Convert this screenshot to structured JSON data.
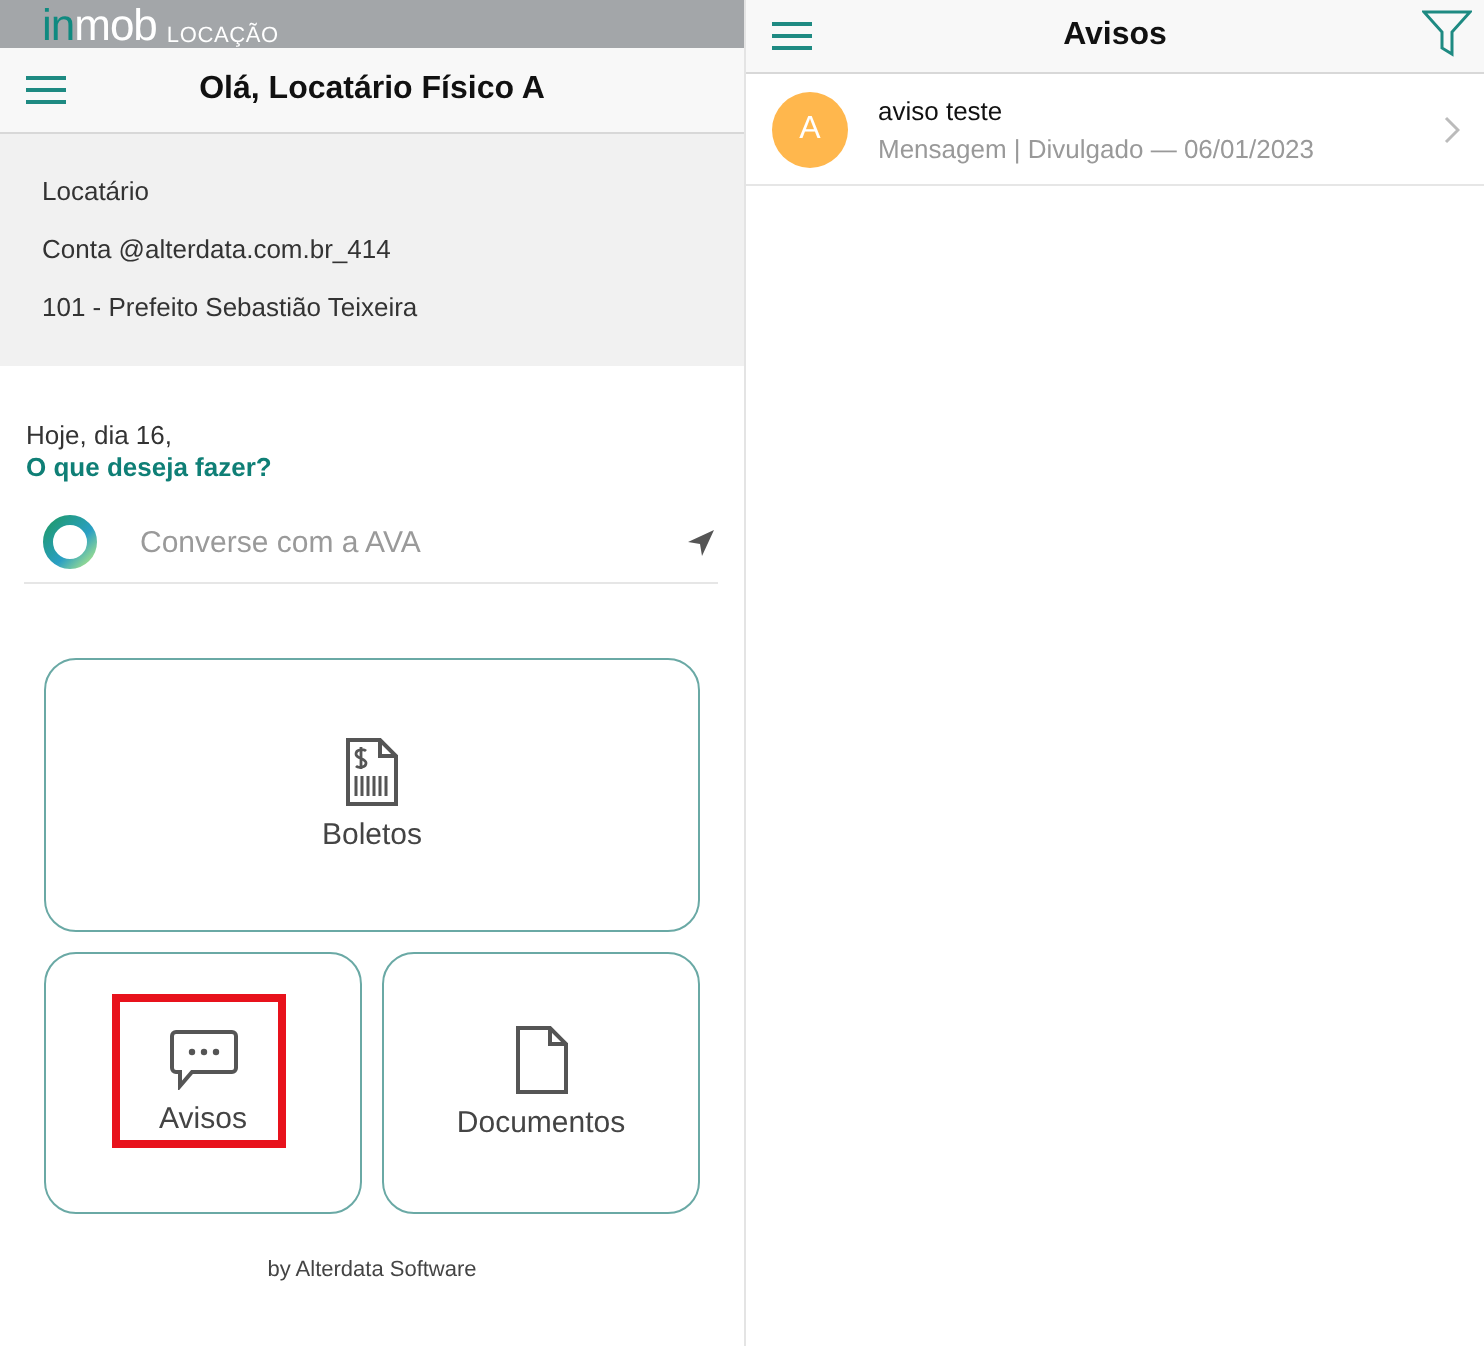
{
  "left": {
    "brand": {
      "name_accent": "in",
      "name": "mob",
      "product": "LOCAÇÃO"
    },
    "header": {
      "title": "Olá, Locatário Físico A"
    },
    "account": [
      "Locatário",
      "Conta @alterdata.com.br_414",
      "101 - Prefeito Sebastião Teixeira"
    ],
    "greeting": {
      "line": "Hoje, dia 16,",
      "question": "O que deseja fazer?"
    },
    "chat": {
      "placeholder": "Converse com a AVA"
    },
    "tiles": [
      {
        "kind": "boletos",
        "label": "Boletos",
        "highlighted": false
      },
      {
        "kind": "avisos",
        "label": "Avisos",
        "highlighted": true
      },
      {
        "kind": "documentos",
        "label": "Documentos",
        "highlighted": false
      }
    ],
    "footer": "by Alterdata Software"
  },
  "right": {
    "header": {
      "title": "Avisos"
    },
    "notices": [
      {
        "initial": "A",
        "color": "#ffb74d",
        "title": "aviso teste",
        "subtitle": "Mensagem | Divulgado — 06/01/2023"
      }
    ]
  }
}
